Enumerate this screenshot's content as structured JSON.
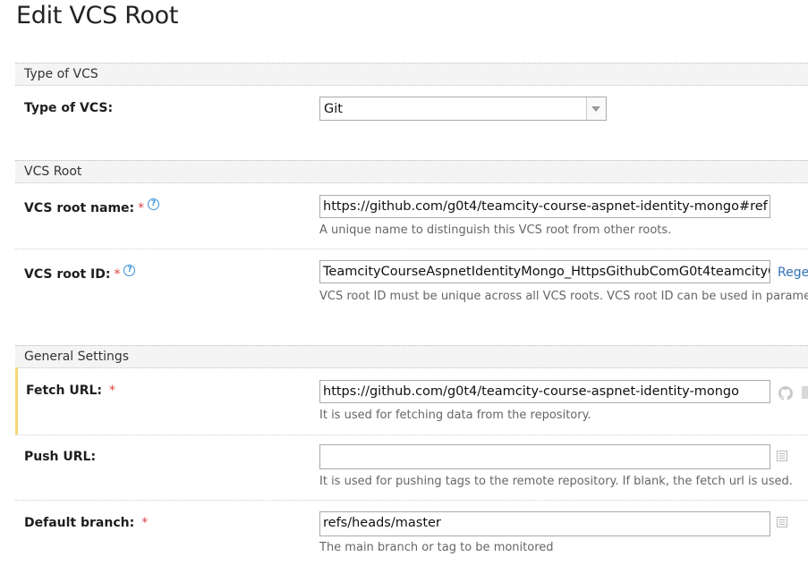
{
  "page": {
    "title": "Edit VCS Root"
  },
  "sections": {
    "type_of_vcs": "Type of VCS",
    "vcs_root": "VCS Root",
    "general_settings": "General Settings"
  },
  "type_of_vcs": {
    "label": "Type of VCS:",
    "value": "Git"
  },
  "vcs_root_name": {
    "label": "VCS root name:",
    "required": "*",
    "help": "?",
    "value": "https://github.com/g0t4/teamcity-course-aspnet-identity-mongo#ref",
    "note": "A unique name to distinguish this VCS root from other roots."
  },
  "vcs_root_id": {
    "label": "VCS root ID:",
    "required": "*",
    "help": "?",
    "value": "TeamcityCourseAspnetIdentityMongo_HttpsGithubComG0t4teamcityC",
    "regenerate": "Rege",
    "note": "VCS root ID must be unique across all VCS roots. VCS root ID can be used in paramet"
  },
  "fetch_url": {
    "label": "Fetch URL:",
    "required": "*",
    "value": "https://github.com/g0t4/teamcity-course-aspnet-identity-mongo",
    "note": "It is used for fetching data from the repository.",
    "icon": "github-icon"
  },
  "push_url": {
    "label": "Push URL:",
    "value": "",
    "note": "It is used for pushing tags to the remote repository. If blank, the fetch url is used.",
    "icon": "list-icon"
  },
  "default_branch": {
    "label": "Default branch:",
    "required": "*",
    "value": "refs/heads/master",
    "note": "The main branch or tag to be monitored",
    "icon": "list-icon"
  },
  "colors": {
    "link": "#3071b8",
    "required": "#dd4444",
    "highlight": "#f6d872"
  }
}
